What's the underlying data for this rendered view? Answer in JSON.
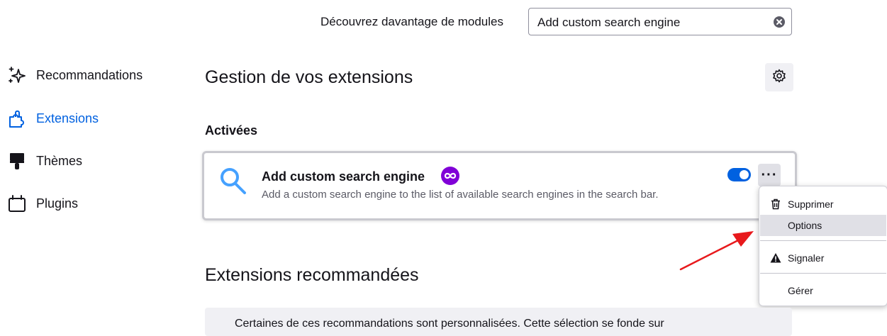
{
  "search": {
    "label": "Découvrez davantage de modules",
    "value": "Add custom search engine"
  },
  "sidebar": {
    "items": [
      {
        "label": "Recommandations",
        "icon": "sparkles-icon",
        "active": false
      },
      {
        "label": "Extensions",
        "icon": "puzzle-icon",
        "active": true
      },
      {
        "label": "Thèmes",
        "icon": "brush-icon",
        "active": false
      },
      {
        "label": "Plugins",
        "icon": "plugin-icon",
        "active": false
      }
    ]
  },
  "main": {
    "title": "Gestion de vos extensions",
    "enabled_heading": "Activées",
    "extension": {
      "name": "Add custom search engine",
      "description": "Add a custom search engine to the list of available search engines in the search bar.",
      "enabled": true,
      "badge_icon": "recommended-badge-icon"
    },
    "more_button_label": "···",
    "recommended_heading": "Extensions recommandées",
    "notice_text": "Certaines de ces recommandations sont personnalisées. Cette sélection se fonde sur"
  },
  "context_menu": {
    "items": [
      {
        "label": "Supprimer",
        "icon": "trash-icon"
      },
      {
        "label": "Options",
        "icon": "",
        "hovered": true
      },
      {
        "label": "Signaler",
        "icon": "warning-icon"
      },
      {
        "label": "Gérer",
        "icon": ""
      }
    ]
  },
  "colors": {
    "accent": "#0061e0",
    "badge": "#8000d7",
    "annotation_arrow": "#e8191c"
  }
}
